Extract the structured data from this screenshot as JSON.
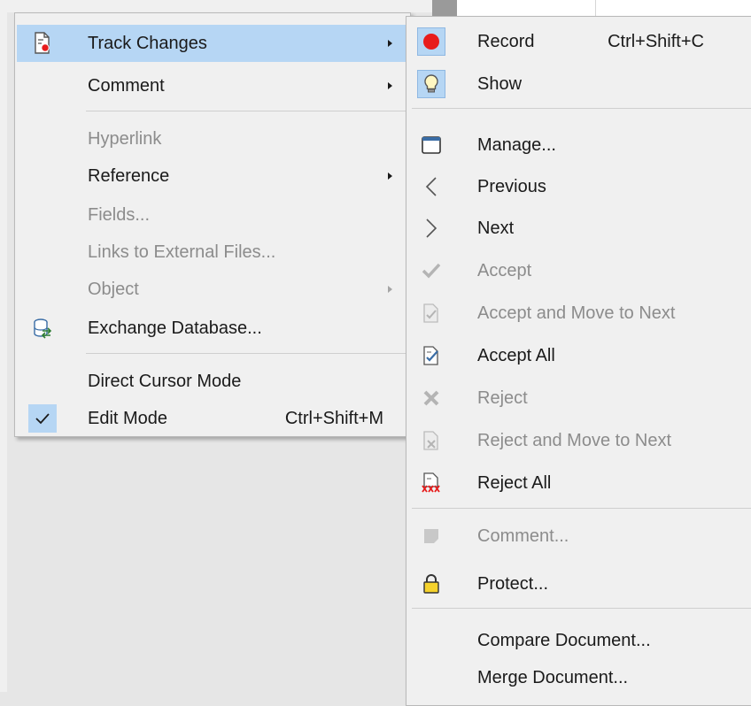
{
  "main_menu": {
    "items": [
      {
        "label": "Track Changes",
        "mnemonic": "",
        "has_submenu": true,
        "enabled": true,
        "highlighted": true,
        "icon": "track-changes-icon"
      },
      {
        "label": "Comment",
        "has_submenu": true,
        "enabled": true,
        "icon": ""
      },
      {
        "label": "Hyperlink",
        "has_submenu": false,
        "enabled": false,
        "icon": ""
      },
      {
        "label": "Reference",
        "has_submenu": true,
        "enabled": true,
        "icon": ""
      },
      {
        "label": "Fields...",
        "has_submenu": false,
        "enabled": false,
        "icon": ""
      },
      {
        "label": "Links to External Files...",
        "has_submenu": false,
        "enabled": false,
        "icon": ""
      },
      {
        "label": "Object",
        "has_submenu": true,
        "enabled": false,
        "icon": ""
      },
      {
        "label": "Exchange Database...",
        "has_submenu": false,
        "enabled": true,
        "icon": "exchange-database-icon"
      },
      {
        "label": "Direct Cursor Mode",
        "has_submenu": false,
        "enabled": true,
        "icon": ""
      },
      {
        "label": "Edit Mode",
        "shortcut": "Ctrl+Shift+M",
        "has_submenu": false,
        "enabled": true,
        "checked": true,
        "icon": "checkmark-icon"
      }
    ]
  },
  "submenu": {
    "items": [
      {
        "label": "Record",
        "shortcut": "Ctrl+Shift+C",
        "enabled": true,
        "checked": true,
        "icon": "record-icon"
      },
      {
        "label": "Show",
        "enabled": true,
        "checked": true,
        "icon": "lightbulb-icon"
      },
      {
        "label": "Manage...",
        "enabled": true,
        "icon": "manage-window-icon"
      },
      {
        "label": "Previous",
        "enabled": true,
        "icon": "chevron-left-icon"
      },
      {
        "label": "Next",
        "enabled": true,
        "icon": "chevron-right-icon"
      },
      {
        "label": "Accept",
        "enabled": false,
        "icon": "accept-check-icon"
      },
      {
        "label": "Accept and Move to Next",
        "enabled": false,
        "icon": "accept-next-icon"
      },
      {
        "label": "Accept All",
        "enabled": true,
        "icon": "accept-all-icon"
      },
      {
        "label": "Reject",
        "enabled": false,
        "icon": "reject-x-icon"
      },
      {
        "label": "Reject and Move to Next",
        "enabled": false,
        "icon": "reject-next-icon"
      },
      {
        "label": "Reject All",
        "enabled": true,
        "icon": "reject-all-icon"
      },
      {
        "label": "Comment...",
        "enabled": false,
        "icon": "comment-note-icon"
      },
      {
        "label": "Protect...",
        "enabled": true,
        "icon": "lock-icon"
      },
      {
        "label": "Compare Document...",
        "enabled": true,
        "icon": ""
      },
      {
        "label": "Merge Document...",
        "enabled": true,
        "icon": ""
      }
    ]
  },
  "colors": {
    "menu_bg": "#f0f0f0",
    "highlight": "#b6d6f4",
    "disabled_text": "#8c8c8c",
    "record_red": "#e81c1c"
  }
}
